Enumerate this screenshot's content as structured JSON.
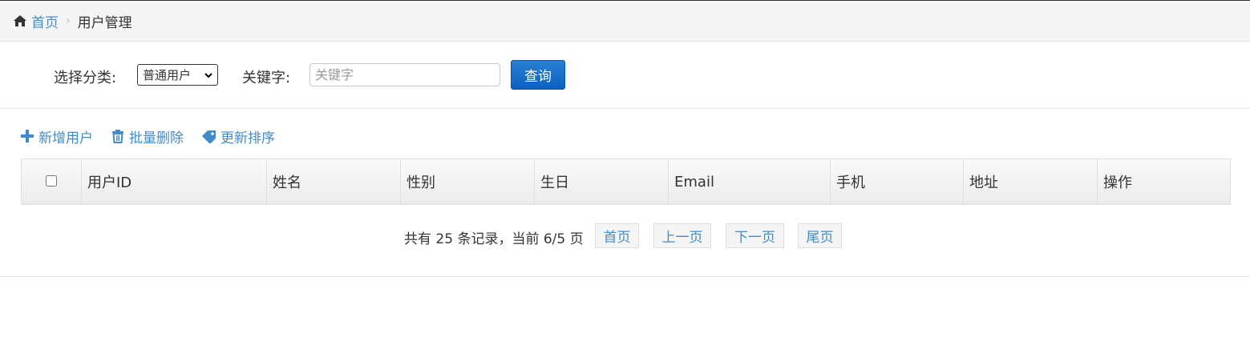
{
  "breadcrumb": {
    "home_icon": "home-icon",
    "home_label": "首页",
    "current_label": "用户管理"
  },
  "filter": {
    "category_label": "选择分类:",
    "category_value": "普通用户",
    "keyword_label": "关键字:",
    "keyword_placeholder": "关键字",
    "query_button": "查询",
    "query_button_color": "#0a60c0"
  },
  "toolbar": {
    "add_user": {
      "label": "新增用户",
      "icon": "plus-icon"
    },
    "batch_delete": {
      "label": "批量删除",
      "icon": "trash-icon"
    },
    "update_sort": {
      "label": "更新排序",
      "icon": "tag-icon"
    },
    "link_color": "#428bca"
  },
  "table": {
    "columns": [
      "用户ID",
      "姓名",
      "性别",
      "生日",
      "Email",
      "手机",
      "地址",
      "操作"
    ]
  },
  "pager": {
    "info": "共有 25 条记录，当前 6/5 页",
    "first": "首页",
    "prev": "上一页",
    "next": "下一页",
    "last": "尾页"
  }
}
